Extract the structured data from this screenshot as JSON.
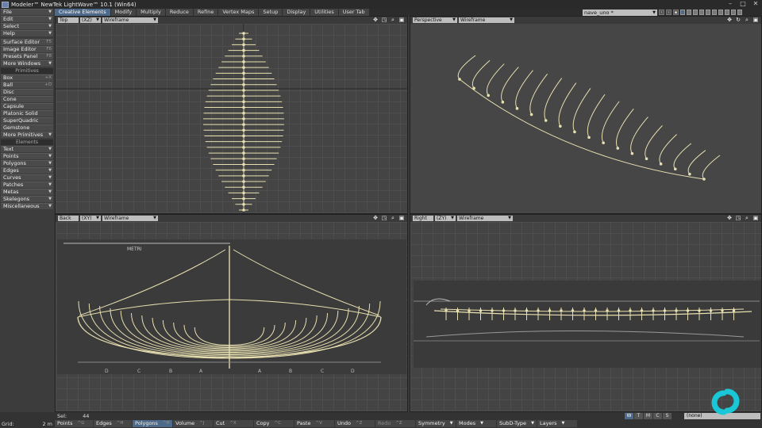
{
  "window": {
    "title": "Modeler™ NewTek LightWave™ 10.1 (Win64)",
    "controls": [
      "–",
      "□",
      "✕"
    ]
  },
  "left_panel": {
    "menus": [
      {
        "label": "File"
      },
      {
        "label": "Edit"
      },
      {
        "label": "Select"
      },
      {
        "label": "Help"
      }
    ],
    "tools": [
      {
        "label": "Surface Editor",
        "shortcut": "F5"
      },
      {
        "label": "Image Editor",
        "shortcut": "F6"
      },
      {
        "label": "Presets Panel",
        "shortcut": "F8"
      },
      {
        "label": "More Windows"
      }
    ],
    "primitives_header": "Primitives",
    "primitives": [
      {
        "label": "Box",
        "shortcut": "+X"
      },
      {
        "label": "Ball",
        "shortcut": "+O"
      },
      {
        "label": "Disc"
      },
      {
        "label": "Cone"
      },
      {
        "label": "Capsule"
      },
      {
        "label": "Platonic Solid"
      },
      {
        "label": "SuperQuadric"
      },
      {
        "label": "Gemstone"
      },
      {
        "label": "More Primitives"
      }
    ],
    "elements_header": "Elements",
    "elements": [
      {
        "label": "Text"
      },
      {
        "label": "Points"
      },
      {
        "label": "Polygons"
      },
      {
        "label": "Edges"
      },
      {
        "label": "Curves"
      },
      {
        "label": "Patches"
      },
      {
        "label": "Metas"
      },
      {
        "label": "Skelegons"
      },
      {
        "label": "Miscellaneous"
      }
    ]
  },
  "tabs": [
    "Creative Elements",
    "Modify",
    "Multiply",
    "Reduce",
    "Refine",
    "Vertex Maps",
    "Setup",
    "Display",
    "Utilities",
    "User Tab"
  ],
  "active_tab": "Creative Elements",
  "object_selector": "nave_uno *",
  "viewports": {
    "top_left": {
      "view": "Top",
      "axes": "(XZ)",
      "mode": "Wireframe"
    },
    "top_right": {
      "view": "Perspective",
      "mode": "Wireframe"
    },
    "bottom_left": {
      "view": "Back",
      "axes": "(XY)",
      "mode": "Wireframe",
      "backdrop_label": "METRI",
      "section_letters": [
        "D",
        "C",
        "B",
        "A",
        "A",
        "B",
        "C",
        "D"
      ]
    },
    "bottom_right": {
      "view": "Right",
      "axes": "(ZY)",
      "mode": "Wireframe"
    }
  },
  "viewport_icons": [
    "move-icon",
    "maximize-icon",
    "zoom-icon",
    "fit-icon"
  ],
  "status": {
    "sel_label": "Sel:",
    "sel_value": "44",
    "grid_label": "Grid:",
    "grid_value": "2 m"
  },
  "bottom_buttons": [
    {
      "label": "Points",
      "key": "^G"
    },
    {
      "label": "Edges",
      "key": "^H"
    },
    {
      "label": "Polygons",
      "key": "^H",
      "active": true
    },
    {
      "label": "Volume",
      "key": "^J"
    },
    {
      "label": "Cut",
      "key": "^X"
    },
    {
      "label": "Copy",
      "key": "^C"
    },
    {
      "label": "Paste",
      "key": "^V"
    },
    {
      "label": "Undo",
      "key": "^Z"
    },
    {
      "label": "Redo",
      "key": "^Z"
    },
    {
      "label": "Symmetry",
      "dropdown": true
    },
    {
      "label": "Modes",
      "dropdown": true
    },
    {
      "label": "SubD-Type",
      "dropdown": true
    },
    {
      "label": "Layers",
      "dropdown": true
    }
  ],
  "wtmcs": [
    "W",
    "T",
    "M",
    "C",
    "S"
  ],
  "vmap_select": "(none)",
  "colors": {
    "accent": "#4d6a8a",
    "wire": "#e8e0b0",
    "viewport_bg": "#444444"
  }
}
